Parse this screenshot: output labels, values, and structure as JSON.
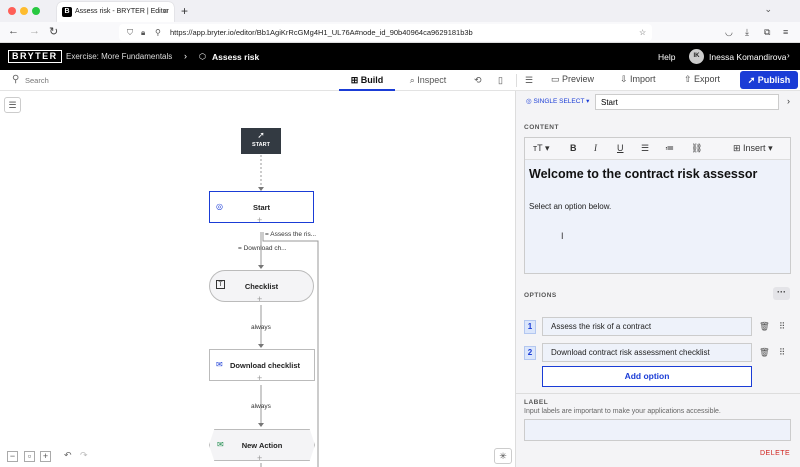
{
  "browser": {
    "tab_title": "Assess risk - BRYTER | Editor",
    "tab_favicon": "B",
    "url": "https://app.bryter.io/editor/Bb1AgiKrRcGMg4H1_UL76A#node_id_90b40964ca9629181b3b"
  },
  "header": {
    "logo": "BRYTER",
    "breadcrumb_parent": "Exercise: More Fundamentals",
    "breadcrumb_current": "Assess risk",
    "help": "Help",
    "avatar_initials": "IK",
    "user_name": "Inessa Komandirova"
  },
  "toolbar": {
    "search_placeholder": "Search",
    "tab_build": "Build",
    "tab_inspect": "Inspect",
    "preview": "Preview",
    "import": "Import",
    "export": "Export",
    "publish": "Publish"
  },
  "canvas": {
    "start_label": "START",
    "nodes": {
      "start": "Start",
      "checklist": "Checklist",
      "download": "Download checklist",
      "new_action": "New Action"
    },
    "edges": {
      "assess": "= Assess the ris...",
      "download": "= Download ch...",
      "always1": "always",
      "always2": "always"
    }
  },
  "panel": {
    "node_type": "SINGLE SELECT",
    "node_name": "Start",
    "content_heading": "CONTENT",
    "insert": "Insert",
    "editor_title": "Welcome to the contract risk assessor",
    "editor_text": "Select an option below.",
    "options_heading": "OPTIONS",
    "options": [
      {
        "num": "1",
        "text": "Assess the risk of a contract"
      },
      {
        "num": "2",
        "text": "Download contract risk assessment checklist"
      }
    ],
    "add_option": "Add option",
    "label_heading": "LABEL",
    "label_hint": "Input labels are important to make your applications accessible.",
    "delete": "DELETE"
  },
  "colors": {
    "accent": "#1a3cd6",
    "header_bg": "#000000",
    "danger": "#d0211c"
  }
}
